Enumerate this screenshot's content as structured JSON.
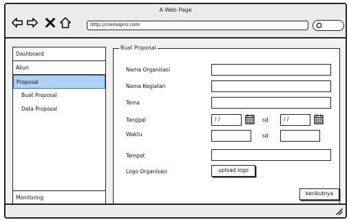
{
  "window": {
    "title": "A Web Page",
    "url": "http://cremopro.com"
  },
  "sidebar": {
    "items": [
      {
        "label": "Dashboard"
      },
      {
        "label": "Akun"
      },
      {
        "label": "Proposal",
        "active": true
      }
    ],
    "subitems": [
      {
        "label": "Buat Proposal"
      },
      {
        "label": "Data Proposal"
      }
    ],
    "bottom": {
      "label": "Monitoring"
    }
  },
  "form": {
    "title": "Buat Proposal",
    "labels": {
      "organisasi": "Nama Organisasi",
      "kegiatan": "Nama Kegiatan",
      "tema": "Tema",
      "tanggal": "Tanggal",
      "waktu": "Waktu",
      "tempat": "Tempat",
      "logo": "Logo Organisasi"
    },
    "tanggal_start": "/ /",
    "tanggal_end": "/ /",
    "sd_label": "sd",
    "upload_label": "upload logo",
    "next_label": "berikutnya"
  },
  "colors": {
    "active_bg": "#b2d2f5",
    "border": "#222222"
  }
}
